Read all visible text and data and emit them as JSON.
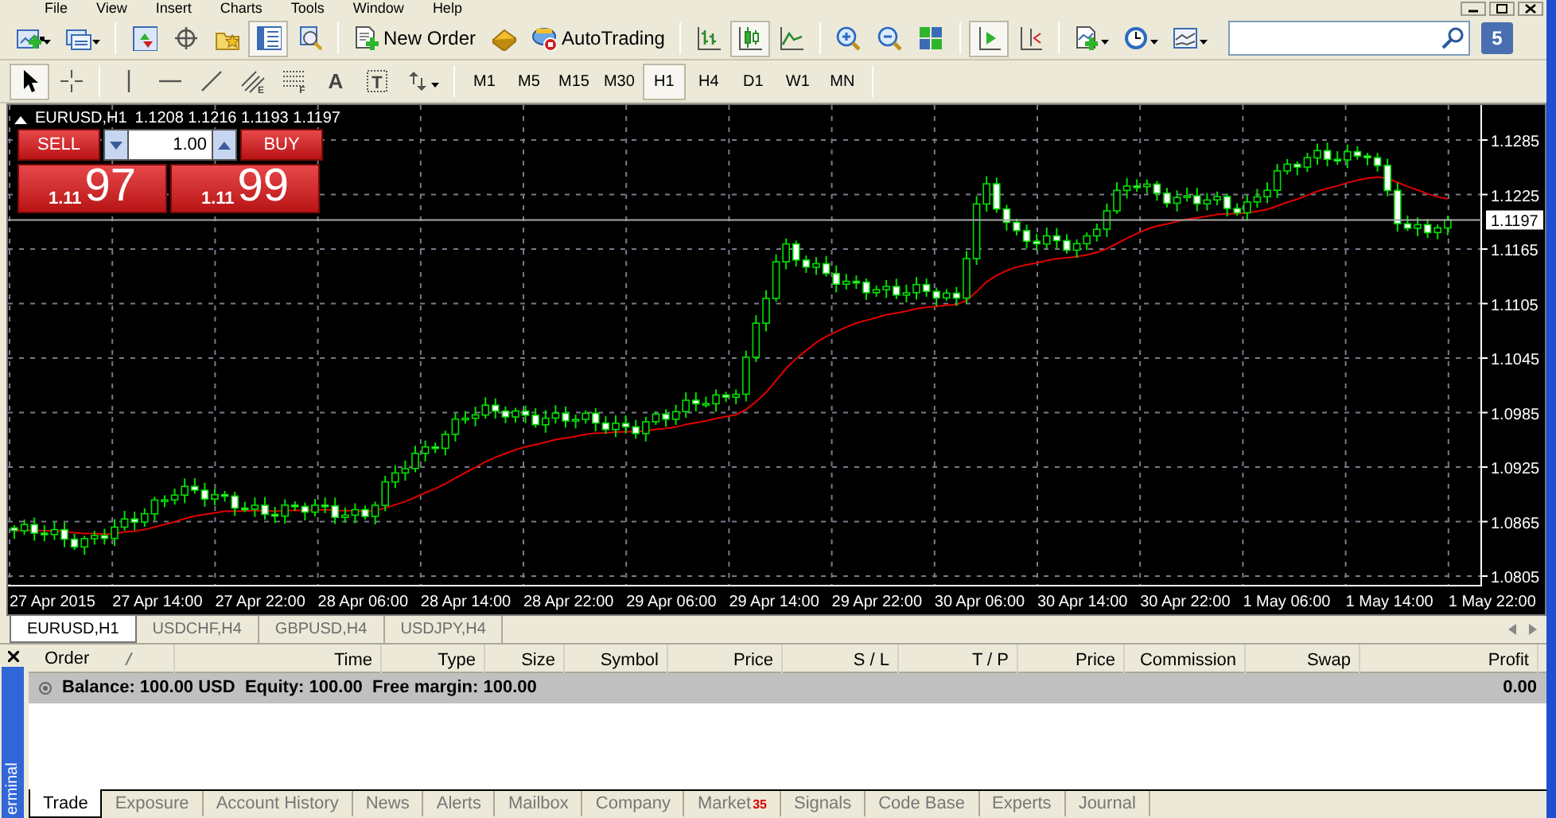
{
  "menu": [
    "File",
    "View",
    "Insert",
    "Charts",
    "Tools",
    "Window",
    "Help"
  ],
  "toolbar": [
    {
      "kind": "new-chart",
      "pressed": false
    },
    {
      "kind": "profiles",
      "pressed": false
    },
    {
      "kind": "separator"
    },
    {
      "kind": "market-watch",
      "pressed": false
    },
    {
      "kind": "data-window",
      "pressed": false
    },
    {
      "kind": "navigator",
      "pressed": false
    },
    {
      "kind": "terminal",
      "pressed": true
    },
    {
      "kind": "tester",
      "pressed": false
    },
    {
      "kind": "separator"
    },
    {
      "kind": "new-order",
      "label": "New Order",
      "pressed": false
    },
    {
      "kind": "editor",
      "pressed": false
    },
    {
      "kind": "autotrading",
      "label": "AutoTrading",
      "pressed": false
    },
    {
      "kind": "separator"
    },
    {
      "kind": "bar-chart",
      "pressed": false
    },
    {
      "kind": "candle-chart",
      "pressed": true
    },
    {
      "kind": "line-chart",
      "pressed": false
    },
    {
      "kind": "separator"
    },
    {
      "kind": "zoom-in",
      "pressed": false
    },
    {
      "kind": "zoom-out",
      "pressed": false
    },
    {
      "kind": "tile",
      "pressed": false
    },
    {
      "kind": "separator"
    },
    {
      "kind": "autoscroll",
      "pressed": true
    },
    {
      "kind": "chart-shift",
      "pressed": false
    },
    {
      "kind": "separator"
    },
    {
      "kind": "indicators",
      "pressed": false
    },
    {
      "kind": "periods",
      "pressed": false
    },
    {
      "kind": "templates",
      "pressed": false
    }
  ],
  "mail_count": "5",
  "drawing_toolbar": [
    {
      "kind": "cursor",
      "pressed": true
    },
    {
      "kind": "crosshair",
      "pressed": false
    },
    {
      "kind": "separator"
    },
    {
      "kind": "vertical-line",
      "pressed": false
    },
    {
      "kind": "horizontal-line",
      "pressed": false
    },
    {
      "kind": "trendline",
      "pressed": false
    },
    {
      "kind": "channel",
      "glyph": "E",
      "pressed": false
    },
    {
      "kind": "fibo",
      "glyph": "F",
      "pressed": false
    },
    {
      "kind": "text",
      "glyph": "A",
      "pressed": false
    },
    {
      "kind": "label",
      "glyph": "T",
      "pressed": false
    },
    {
      "kind": "arrows",
      "pressed": false
    }
  ],
  "timeframes": [
    {
      "label": "M1",
      "selected": false
    },
    {
      "label": "M5",
      "selected": false
    },
    {
      "label": "M15",
      "selected": false
    },
    {
      "label": "M30",
      "selected": false
    },
    {
      "label": "H1",
      "selected": true
    },
    {
      "label": "H4",
      "selected": false
    },
    {
      "label": "D1",
      "selected": false
    },
    {
      "label": "W1",
      "selected": false
    },
    {
      "label": "MN",
      "selected": false
    }
  ],
  "chart": {
    "symbol": "EURUSD,H1",
    "ohlc": [
      "1.1208",
      "1.1216",
      "1.1193",
      "1.1197"
    ],
    "one_click": {
      "sell_label": "SELL",
      "buy_label": "BUY",
      "volume": "1.00",
      "sell_big": "1.11",
      "sell_pips": "97",
      "buy_big": "1.11",
      "buy_pips": "99"
    },
    "current_price": "1.1197",
    "y_axis_labels": [
      "1.1285",
      "1.1225",
      "1.1165",
      "1.1105",
      "1.1045",
      "1.0985",
      "1.0925",
      "1.0865",
      "1.0805"
    ],
    "x_axis_labels": [
      "27 Apr 2015",
      "27 Apr 14:00",
      "27 Apr 22:00",
      "28 Apr 06:00",
      "28 Apr 14:00",
      "28 Apr 22:00",
      "29 Apr 06:00",
      "29 Apr 14:00",
      "29 Apr 22:00",
      "30 Apr 06:00",
      "30 Apr 14:00",
      "30 Apr 22:00",
      "1 May 06:00",
      "1 May 14:00",
      "1 May 22:00"
    ]
  },
  "chart_tabs": [
    {
      "label": "EURUSD,H1",
      "selected": true
    },
    {
      "label": "USDCHF,H4",
      "selected": false
    },
    {
      "label": "GBPUSD,H4",
      "selected": false
    },
    {
      "label": "USDJPY,H4",
      "selected": false
    }
  ],
  "terminal": {
    "side_label": "erminal",
    "columns": [
      "Order",
      "Time",
      "Type",
      "Size",
      "Symbol",
      "Price",
      "S / L",
      "T / P",
      "Price",
      "Commission",
      "Swap",
      "Profit"
    ],
    "balance_row": {
      "summary": "Balance: 100.00 USD  Equity: 100.00  Free margin: 100.00",
      "profit": "0.00"
    },
    "tabs": [
      {
        "label": "Trade",
        "selected": true
      },
      {
        "label": "Exposure",
        "selected": false
      },
      {
        "label": "Account History",
        "selected": false
      },
      {
        "label": "News",
        "selected": false
      },
      {
        "label": "Alerts",
        "selected": false
      },
      {
        "label": "Mailbox",
        "selected": false
      },
      {
        "label": "Company",
        "selected": false
      },
      {
        "label": "Market",
        "badge": "35",
        "selected": false
      },
      {
        "label": "Signals",
        "selected": false
      },
      {
        "label": "Code Base",
        "selected": false
      },
      {
        "label": "Experts",
        "selected": false
      },
      {
        "label": "Journal",
        "selected": false
      }
    ]
  }
}
